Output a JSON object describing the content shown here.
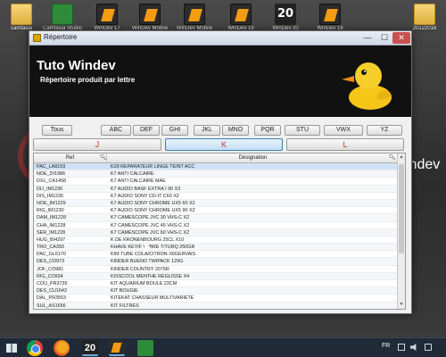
{
  "desktop": {
    "icons": [
      {
        "name": "folder-icon",
        "label": "camtasia",
        "kind": "folder"
      },
      {
        "name": "camtasia-app-icon",
        "label": "Camtasia Studio",
        "kind": "green"
      },
      {
        "name": "windev-17-icon",
        "label": "WinDev 17",
        "kind": "orange"
      },
      {
        "name": "windev-mobile-icon",
        "label": "WinDev Mobile",
        "kind": "orange"
      },
      {
        "name": "windev-mobile-2-icon",
        "label": "WinDev Mobile",
        "kind": "orange"
      },
      {
        "name": "windev-19-icon",
        "label": "WinDev 19",
        "kind": "orange"
      },
      {
        "name": "windev-20-icon",
        "label": "WinDev 20",
        "kind": "twenty"
      },
      {
        "name": "windev-18-icon",
        "label": "WinDev 18",
        "kind": "orange"
      },
      {
        "name": "folder-date-icon",
        "label": "20122016",
        "kind": "folder"
      }
    ],
    "bg_text": "indev"
  },
  "window": {
    "title": "Répertoire",
    "controls": {
      "minimize": "—",
      "maximize": "☐",
      "close": "✕"
    }
  },
  "banner": {
    "title": "Tuto Windev",
    "subtitle": "Répertoire produit par lettre"
  },
  "letter_buttons": [
    "Tous",
    "ABC",
    "DEF",
    "GHI",
    "JKL",
    "MNO",
    "PQR",
    "STU",
    "VWX",
    "YZ"
  ],
  "big_buttons": [
    {
      "label": "J",
      "active": false
    },
    {
      "label": "K",
      "active": true
    },
    {
      "label": "L",
      "active": false
    }
  ],
  "table": {
    "headers": {
      "ref": "Ref",
      "designation": "Désignation"
    },
    "selected_index": 0,
    "rows": [
      {
        "ref": "PAC_LA8159",
        "des": "K29 REPARATEUR LINGE TEINT ACC"
      },
      {
        "ref": "NOE_DI1986",
        "des": "K7 ANTI CALCAIRE"
      },
      {
        "ref": "DXL_CA1458",
        "des": "K7 ANTI CALCAIRE MAE"
      },
      {
        "ref": "DIJ_IM1236",
        "des": "K7 AUDIO BASF EXTRA I 90 X3"
      },
      {
        "ref": "DIS_IM1235",
        "des": "K7 AUDIO SONY CD-IT C60 X2"
      },
      {
        "ref": "NOE_IM1229",
        "des": "K7 AUDIO SONY CHROME UX5 60 X2"
      },
      {
        "ref": "RIG_IM1230",
        "des": "K7 AUDIO SONY CHROME UX5 90 X2"
      },
      {
        "ref": "DAM_IM1228",
        "des": "K7 CAMESCOPE JVC 30 VHS-C X2"
      },
      {
        "ref": "CHA_IM1228",
        "des": "K7 CAMESCOPE JVC 45 VHS-C X2"
      },
      {
        "ref": "SER_IM1228",
        "des": "K7 CAMESCOPE JVC 60 VHS-C X2"
      },
      {
        "ref": "HUG_BI4297",
        "des": "K DE KRONENBOURG 25CL X10"
      },
      {
        "ref": "TRO_CA393",
        "des": "KHAVE KEYIF VABRE T/TURQ 250GR"
      },
      {
        "ref": "PAC_GL6170",
        "des": "KIM TUBE COLA/CITRON X6GERVAIS"
      },
      {
        "ref": "DES_CO973",
        "des": "KINDER BUENO TWIPACK 129G"
      },
      {
        "ref": "JOF_CO981",
        "des": "KINDER COUNTRY 2075R"
      },
      {
        "ref": "RIG_CO934",
        "des": "KISSCOOL MENTHE REGLISSE X4"
      },
      {
        "ref": "COU_PR3735",
        "des": "KIT AQUARIUM BOULE 23CM"
      },
      {
        "ref": "DES_CU1643",
        "des": "KIT BOUGIE"
      },
      {
        "ref": "DAL_PR3553",
        "des": "KITEKAT CHASSEUR MULTIVARIETE"
      },
      {
        "ref": "SUL_AS1656",
        "des": "KIT FILTRES"
      }
    ]
  },
  "taskbar": {
    "lang": "FR"
  },
  "colors": {
    "banner_bg": "#111111",
    "selected_row": "#cfe3f7",
    "big_button_text": "#c0392b"
  }
}
